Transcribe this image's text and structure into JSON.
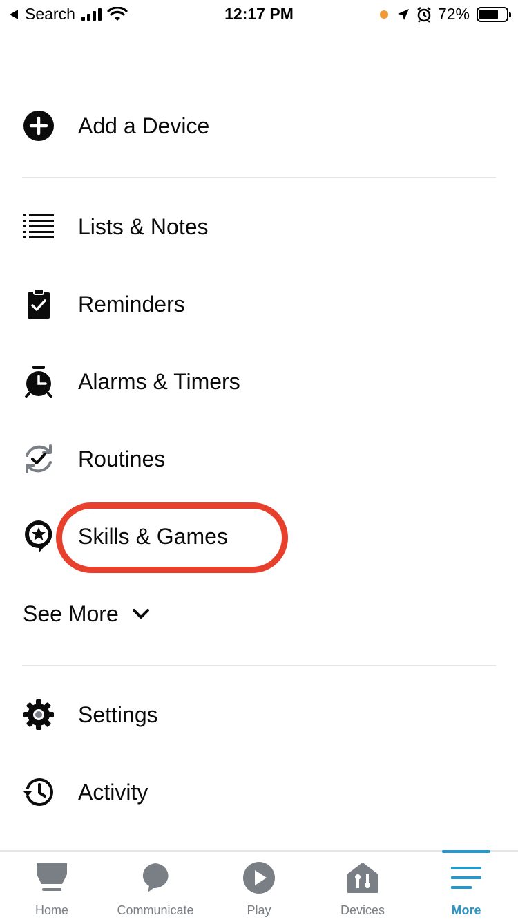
{
  "status_bar": {
    "back_label": "Search",
    "time": "12:17 PM",
    "battery_text": "72%",
    "battery_level": 0.72
  },
  "menu": {
    "items": [
      {
        "label": "Add a Device",
        "icon": "add-circle-icon"
      },
      {
        "label": "Lists & Notes",
        "icon": "list-icon"
      },
      {
        "label": "Reminders",
        "icon": "clipboard-check-icon"
      },
      {
        "label": "Alarms & Timers",
        "icon": "alarm-clock-icon"
      },
      {
        "label": "Routines",
        "icon": "routine-check-icon"
      },
      {
        "label": "Skills & Games",
        "icon": "skills-bubble-icon"
      }
    ],
    "see_more_label": "See More",
    "settings_items": [
      {
        "label": "Settings",
        "icon": "gear-icon"
      },
      {
        "label": "Activity",
        "icon": "history-icon"
      }
    ]
  },
  "tab_bar": {
    "tabs": [
      {
        "label": "Home",
        "icon": "home-icon",
        "active": false
      },
      {
        "label": "Communicate",
        "icon": "chat-bubble-icon",
        "active": false
      },
      {
        "label": "Play",
        "icon": "play-icon",
        "active": false
      },
      {
        "label": "Devices",
        "icon": "devices-icon",
        "active": false
      },
      {
        "label": "More",
        "icon": "menu-icon",
        "active": true
      }
    ]
  },
  "colors": {
    "accent": "#2b97c9",
    "highlight": "#e7402d",
    "inactive_tab": "#7a7f85",
    "divider": "#e3e5e8"
  }
}
